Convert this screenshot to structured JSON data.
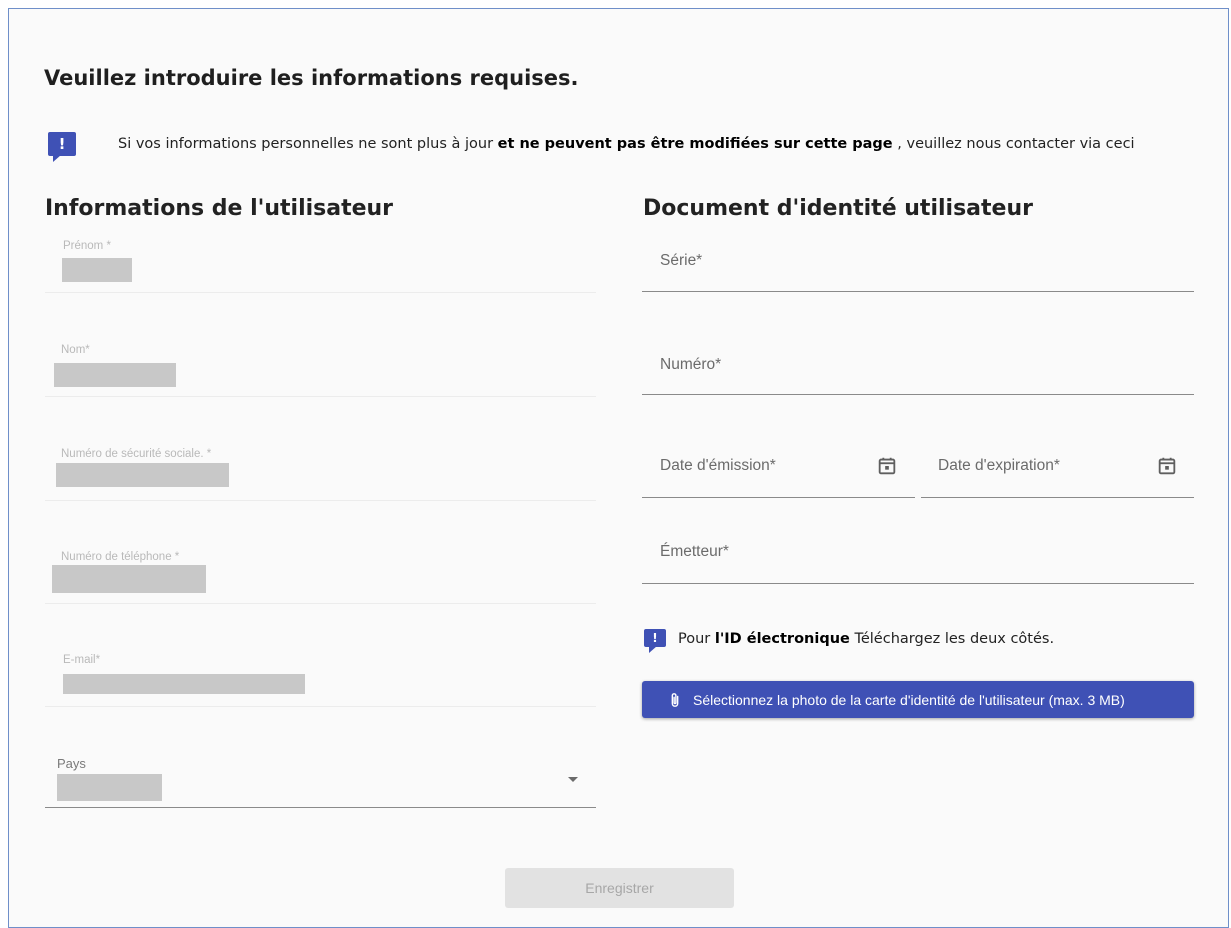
{
  "page": {
    "title": "Veuillez introduire les informations requises.",
    "notice": {
      "icon": "feedback-icon",
      "text_before": "Si vos informations personnelles ne sont plus à jour ",
      "text_bold": "et ne peuvent pas être modifiées sur cette page",
      "text_after": " , veuillez nous contacter via ceci"
    }
  },
  "user_info": {
    "heading": "Informations de l'utilisateur",
    "fields": [
      {
        "label": "Prénom *"
      },
      {
        "label": "Nom*"
      },
      {
        "label": "Numéro de sécurité sociale. *"
      },
      {
        "label": "Numéro de téléphone *"
      },
      {
        "label": "E-mail*"
      }
    ],
    "country": {
      "label": "Pays",
      "icon": "dropdown-arrow-icon"
    }
  },
  "id_document": {
    "heading": "Document d'identité utilisateur",
    "series_placeholder": "Série*",
    "number_placeholder": "Numéro*",
    "issue_date_placeholder": "Date d'émission*",
    "expiry_date_placeholder": "Date d'expiration*",
    "issuer_placeholder": "Émetteur*",
    "eid_note": {
      "icon": "feedback-icon",
      "before": "Pour ",
      "bold": "l'ID électronique",
      "after": " Téléchargez les deux côtés."
    },
    "upload_button": {
      "icon": "paperclip-icon",
      "label": "Sélectionnez la photo de la carte d'identité de l'utilisateur (max. 3 MB)"
    }
  },
  "actions": {
    "save_label": "Enregistrer"
  },
  "colors": {
    "accent": "#3f51b5",
    "disabled_bg": "#e2e2e2",
    "frame_border": "#6f8fc9"
  }
}
